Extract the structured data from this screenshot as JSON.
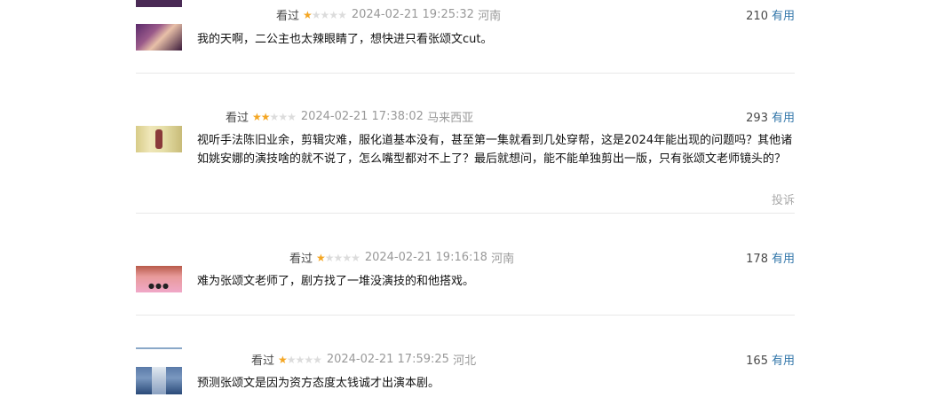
{
  "comments": [
    {
      "status": "看过",
      "rating": 1,
      "time": "2024-02-21 19:25:32",
      "location": "河南",
      "votes": "210",
      "useful_label": "有用",
      "text": "我的天啊，二公主也太辣眼睛了，想快进只看张颂文cut。"
    },
    {
      "status": "看过",
      "rating": 2,
      "time": "2024-02-21 17:38:02",
      "location": "马来西亚",
      "votes": "293",
      "useful_label": "有用",
      "text": "视听手法陈旧业余，剪辑灾难，服化道基本没有，甚至第一集就看到几处穿帮，这是2024年能出现的问题吗？其他诸如姚安娜的演技啥的就不说了，怎么嘴型都对不上了？最后就想问，能不能单独剪出一版，只有张颂文老师镜头的？",
      "report_label": "投诉"
    },
    {
      "status": "看过",
      "rating": 1,
      "time": "2024-02-21 19:16:18",
      "location": "河南",
      "votes": "178",
      "useful_label": "有用",
      "text": "难为张颂文老师了，剧方找了一堆没演技的和他搭戏。"
    },
    {
      "status": "看过",
      "rating": 1,
      "time": "2024-02-21 17:59:25",
      "location": "河北",
      "votes": "165",
      "useful_label": "有用",
      "text": "预测张颂文是因为资方态度太钱诚才出演本剧。"
    }
  ],
  "colors": {
    "star": "#f4a623",
    "link": "#3377aa",
    "meta": "#999999"
  }
}
